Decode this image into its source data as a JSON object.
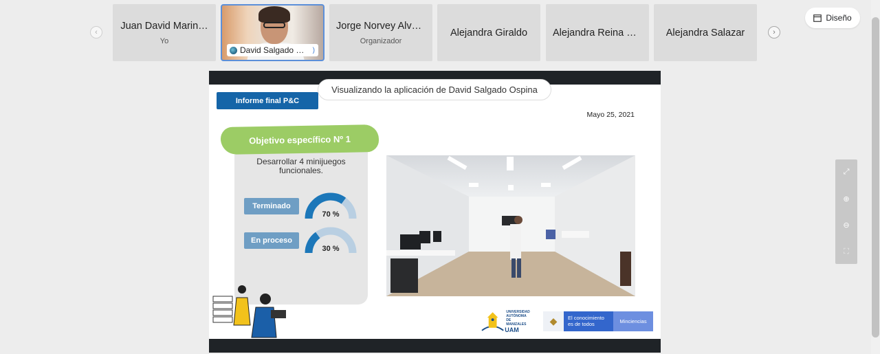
{
  "participants": {
    "prev_icon": "chevron-left-icon",
    "next_icon": "chevron-right-icon",
    "tiles": [
      {
        "name": "Juan David Marin…",
        "role": "Yo"
      },
      {
        "name": "Jorge Norvey Alva…",
        "role": "Organizador"
      },
      {
        "name": "Alejandra Giraldo",
        "role": ""
      },
      {
        "name": "Alejandra Reina H…",
        "role": ""
      },
      {
        "name": "Alejandra Salazar",
        "role": ""
      }
    ],
    "video_tile": {
      "name": "David Salgado …",
      "border_color": "#5b8fd9"
    }
  },
  "layout_button": {
    "label": "Diseño",
    "icon": "layout-icon"
  },
  "share": {
    "viewing_label": "Visualizando la aplicación de David Salgado Ospina"
  },
  "slide": {
    "title": "Informe final P&C",
    "date": "Mayo 25, 2021",
    "objective_title": "Objetivo específico Nº 1",
    "objective_desc_line1": "Desarrollar 4 minijuegos",
    "objective_desc_line2": "funcionales.",
    "statuses": [
      {
        "label": "Terminado",
        "value_text": "70 %",
        "fraction": 0.7
      },
      {
        "label": "En proceso",
        "value_text": "30 %",
        "fraction": 0.3
      }
    ],
    "uam_logo": {
      "line1": "UNIVERSIDAD",
      "line2": "AUTÓNOMA DE",
      "line3": "MANIZALES",
      "big": "UAM"
    },
    "gov_logo": {
      "slogan_line1": "El conocimiento",
      "slogan_line2": "es de todos",
      "brand": "Minciencias"
    },
    "accent_color": "#1565a8",
    "banner_color": "#9ccc65"
  },
  "side_tools": [
    "fullscreen-icon",
    "zoom-in-icon",
    "zoom-out-icon",
    "fit-icon"
  ]
}
